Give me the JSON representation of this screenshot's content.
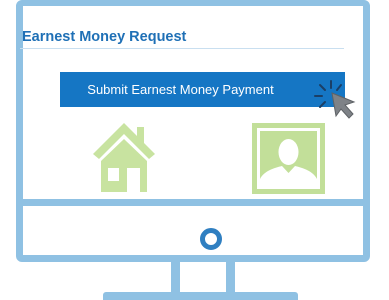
{
  "page": {
    "title": "Earnest Money Request",
    "submit_button_label": "Submit Earnest Money Payment"
  },
  "icons": {
    "house": "house-icon",
    "profile": "person-silhouette-icon",
    "cursor": "mouse-pointer-icon"
  },
  "colors": {
    "accent_blue": "#1576c4",
    "title_blue": "#1f70b6",
    "monitor_frame": "#8fc1e3",
    "house_green": "#c8e3a0",
    "profile_green": "#c2df99",
    "cursor_gray": "#7e8287"
  }
}
